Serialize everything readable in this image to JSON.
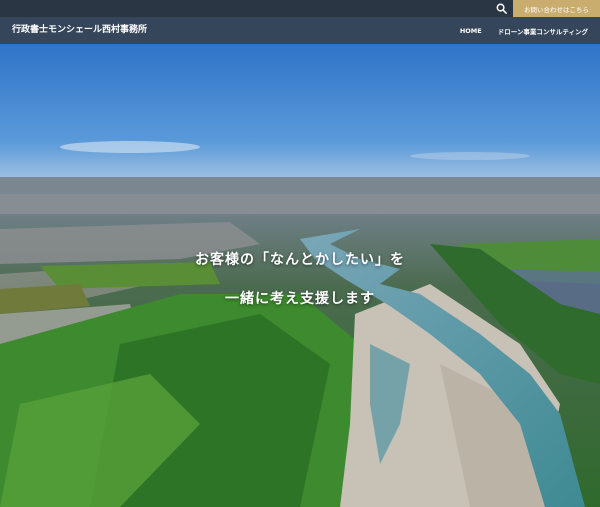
{
  "topbar": {
    "search_icon": "search-icon",
    "contact_label": "お問い合わせはこちら"
  },
  "header": {
    "site_title": "行政書士モンシェール西村事務所",
    "nav": [
      {
        "label": "HOME"
      },
      {
        "label": "ドローン事業コンサルティング"
      }
    ]
  },
  "hero": {
    "line1": "お客様の「なんとかしたい」を",
    "line2": "一緒に考え支援します"
  },
  "colors": {
    "topbar": "#2b3645",
    "navbar": "#36465a",
    "accent": "#c9ad6e"
  }
}
